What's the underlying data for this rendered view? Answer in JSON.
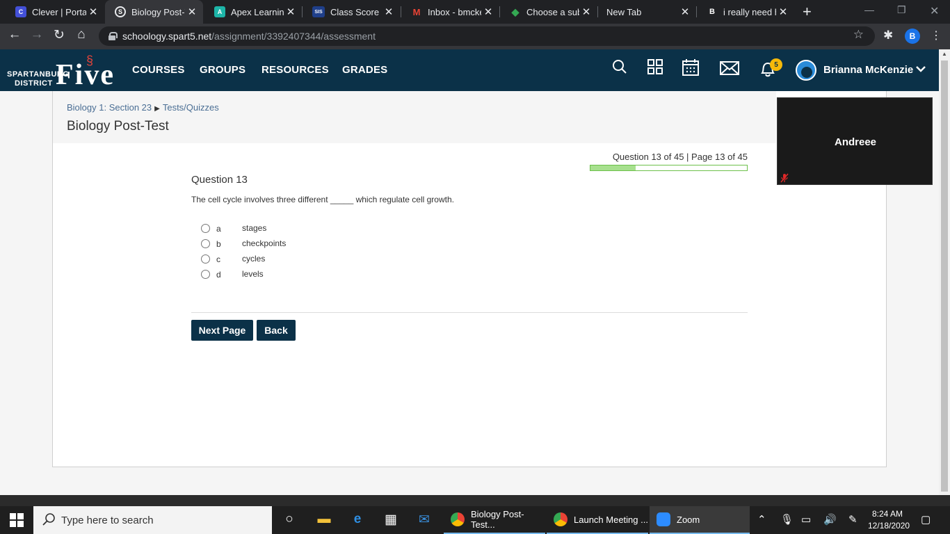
{
  "browser": {
    "tabs": [
      {
        "title": "Clever | Portal",
        "favicon": "C",
        "color": "#4350d8",
        "active": false
      },
      {
        "title": "Biology Post-T",
        "favicon": "S",
        "color": "#35363a",
        "active": true
      },
      {
        "title": "Apex Learning",
        "favicon": "A",
        "color": "#1db5a8",
        "active": false
      },
      {
        "title": "Class Score De",
        "favicon": "SIS",
        "color": "#1f3f8a",
        "active": false
      },
      {
        "title": "Inbox - bmcke",
        "favicon": "M",
        "color": "#ea4335",
        "active": false
      },
      {
        "title": "Choose a subje",
        "favicon": "◆",
        "color": "#34a853",
        "active": false
      },
      {
        "title": "New Tab",
        "favicon": "",
        "color": "#202124",
        "active": false
      },
      {
        "title": "i really need h",
        "favicon": "B",
        "color": "#202124",
        "active": false
      }
    ],
    "url_host": "schoology.spart5.net",
    "url_path": "/assignment/3392407344/assessment",
    "profile_initial": "B"
  },
  "header": {
    "logo": {
      "line1": "SPARTANBURG",
      "line2": "DISTRICT",
      "line3": "Five"
    },
    "nav": [
      "COURSES",
      "GROUPS",
      "RESOURCES",
      "GRADES"
    ],
    "notification_count": "5",
    "user_name": "Brianna McKenzie"
  },
  "page": {
    "breadcrumb": {
      "course": "Biology 1: Section 23",
      "section": "Tests/Quizzes"
    },
    "title": "Biology Post-Test",
    "progress_text": "Question 13 of 45 | Page 13 of 45",
    "progress_fraction": 0.289,
    "question": {
      "heading": "Question 13",
      "text": "The cell cycle involves three different _____ which regulate cell growth.",
      "choices": [
        {
          "letter": "a",
          "answer": "stages"
        },
        {
          "letter": "b",
          "answer": "checkpoints"
        },
        {
          "letter": "c",
          "answer": "cycles"
        },
        {
          "letter": "d",
          "answer": "levels"
        }
      ]
    },
    "buttons": {
      "next": "Next Page",
      "back": "Back"
    }
  },
  "zoom": {
    "participant": "Andreee"
  },
  "taskbar": {
    "search_placeholder": "Type here to search",
    "apps": [
      {
        "label": "Biology Post-Test...",
        "color": "#4285f4"
      },
      {
        "label": "Launch Meeting ...",
        "color": "#4285f4"
      },
      {
        "label": "Zoom",
        "color": "#2d8cff"
      }
    ],
    "time": "8:24 AM",
    "date": "12/18/2020"
  }
}
